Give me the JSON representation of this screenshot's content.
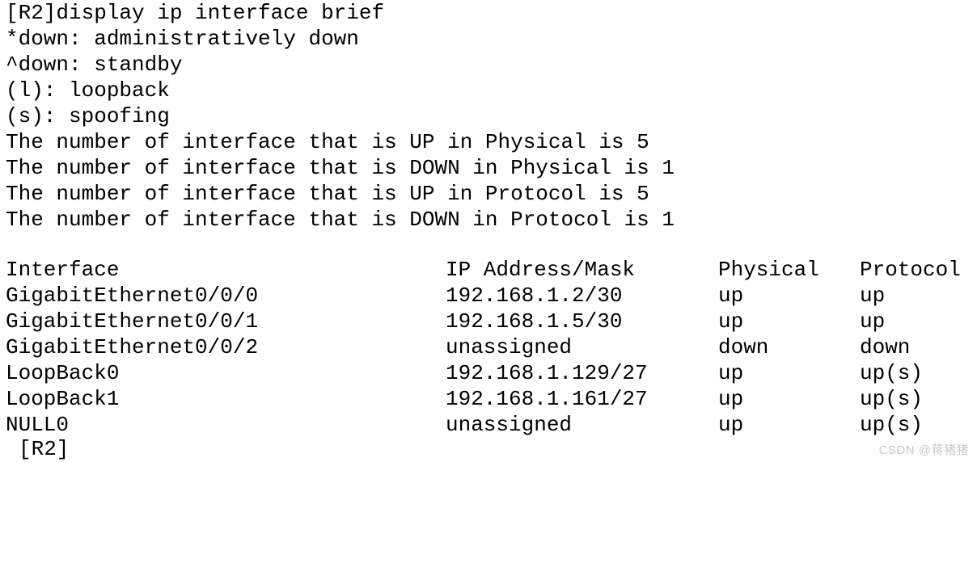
{
  "terminal": {
    "prompt_command_line": "[R2]display ip interface brief",
    "legend": [
      "*down: administratively down",
      "^down: standby",
      "(l): loopback",
      "(s): spoofing"
    ],
    "counters": [
      "The number of interface that is UP in Physical is 5",
      "The number of interface that is DOWN in Physical is 1",
      "The number of interface that is UP in Protocol is 5",
      "The number of interface that is DOWN in Protocol is 1"
    ],
    "counter_values": {
      "up_physical": 5,
      "down_physical": 1,
      "up_protocol": 5,
      "down_protocol": 1
    },
    "table": {
      "headers": {
        "interface": "Interface",
        "ip": "IP Address/Mask",
        "physical": "Physical",
        "protocol": "Protocol"
      },
      "rows": [
        {
          "interface": "GigabitEthernet0/0/0",
          "ip": "192.168.1.2/30",
          "physical": "up",
          "protocol": "up"
        },
        {
          "interface": "GigabitEthernet0/0/1",
          "ip": "192.168.1.5/30",
          "physical": "up",
          "protocol": "up"
        },
        {
          "interface": "GigabitEthernet0/0/2",
          "ip": "unassigned",
          "physical": "down",
          "protocol": "down"
        },
        {
          "interface": "LoopBack0",
          "ip": "192.168.1.129/27",
          "physical": "up",
          "protocol": "up(s)"
        },
        {
          "interface": "LoopBack1",
          "ip": "192.168.1.161/27",
          "physical": "up",
          "protocol": "up(s)"
        },
        {
          "interface": "NULL0",
          "ip": "unassigned",
          "physical": "up",
          "protocol": "up(s)"
        }
      ]
    },
    "trailing_prompt": "[R2]"
  },
  "watermark": {
    "text": "CSDN @蒋猪猪"
  },
  "colors": {
    "background": "#ffffff",
    "text": "#000000",
    "watermark": "#c8c8c8"
  }
}
